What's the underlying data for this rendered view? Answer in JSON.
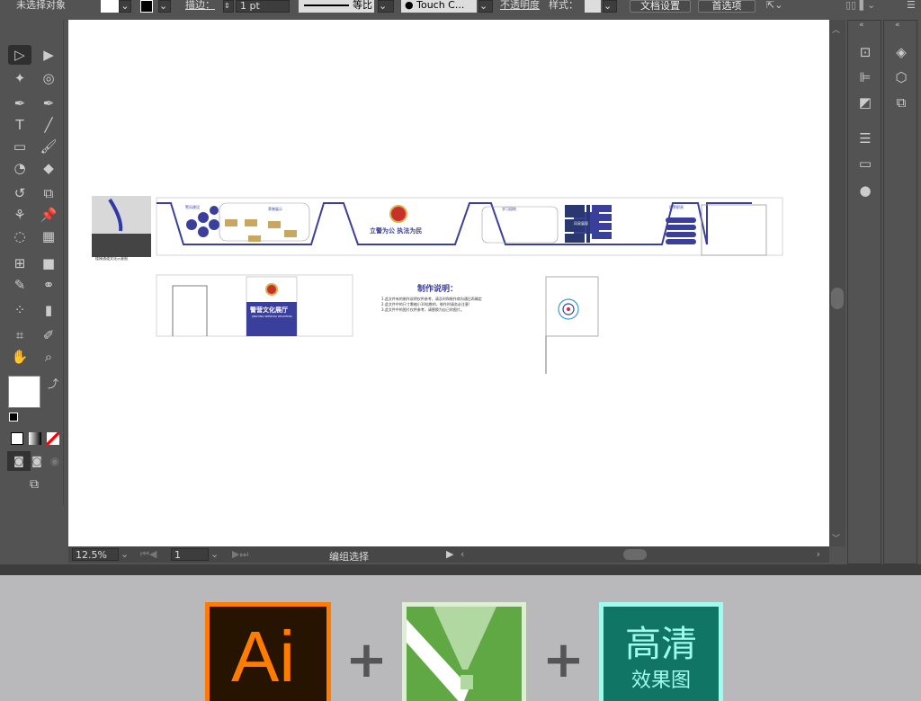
{
  "control_bar": {
    "selection": "未选择对象",
    "stroke_label": "描边：",
    "stroke_weight": "1 pt",
    "stroke_profile": "等比",
    "brush": "Touch C...",
    "opacity_label": "不透明度",
    "style_label": "样式：",
    "doc_setup": "文档设置",
    "preferences": "首选项"
  },
  "status_bar": {
    "zoom": "12.5%",
    "artboard": "1",
    "tool_status": "编组选择"
  },
  "artwork": {
    "caption_photo": "楼梯通道文化示意图",
    "slogan": "立警为公  执法为民",
    "sign_title": "警营文化展厅",
    "sign_subtitle": "JINGYING WENHUA ZHANTING",
    "notes_title": "制作说明：",
    "notes": [
      "1.此文件有的制作说明仅供参考，请及时和制作商沟通后再确定",
      "2.此文件中的尺寸需缩小10倍数的，制作时请务必注意!",
      "3.此文件中的图片仅供参考，请替换为自己的图片。"
    ],
    "panel_titles": [
      "警风建设",
      "荣誉展示",
      "学习园地",
      "风采展现",
      "民警职责"
    ]
  },
  "badges": {
    "ai": "Ai",
    "hd_line1": "高清",
    "hd_line2": "效果图",
    "plus": "+"
  },
  "colors": {
    "accent": "#3b3f9c",
    "ai_bg": "#261300",
    "ai_fg": "#ff7c00",
    "corel_green": "#5fa843",
    "hd_bg": "#117566",
    "hd_border": "#9efbee"
  }
}
